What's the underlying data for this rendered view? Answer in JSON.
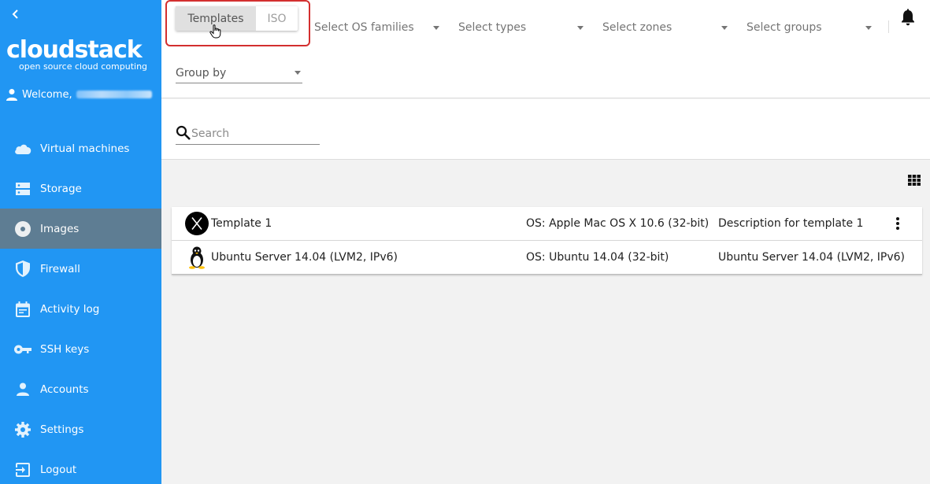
{
  "sidebar": {
    "logo": "cloudstack",
    "tagline": "open source cloud computing",
    "welcome": "Welcome,",
    "items": [
      {
        "label": "Virtual machines",
        "icon": "cloud-icon"
      },
      {
        "label": "Storage",
        "icon": "storage-icon"
      },
      {
        "label": "Images",
        "icon": "disc-icon",
        "active": true
      },
      {
        "label": "Firewall",
        "icon": "shield-icon"
      },
      {
        "label": "Activity log",
        "icon": "calendar-icon"
      },
      {
        "label": "SSH keys",
        "icon": "key-icon"
      },
      {
        "label": "Accounts",
        "icon": "person-icon"
      },
      {
        "label": "Settings",
        "icon": "gear-icon"
      },
      {
        "label": "Logout",
        "icon": "logout-icon"
      }
    ]
  },
  "header": {
    "toggle": {
      "selected": "Templates",
      "other": "ISO"
    },
    "filters": {
      "os_families": "Select OS families",
      "types": "Select types",
      "zones": "Select zones",
      "groups": "Select groups"
    },
    "group_by": "Group by"
  },
  "search": {
    "placeholder": "Search"
  },
  "rows": [
    {
      "icon": "macos-icon",
      "name": "Template 1",
      "os": "OS: Apple Mac OS X 10.6 (32-bit)",
      "description": "Description for template 1"
    },
    {
      "icon": "linux-icon",
      "name": "Ubuntu Server 14.04 (LVM2, IPv6)",
      "os": "OS: Ubuntu 14.04 (32-bit)",
      "description": "Ubuntu Server 14.04 (LVM2, IPv6)"
    }
  ],
  "colors": {
    "sidebar": "#2196f3",
    "active": "#5e7d93",
    "highlight": "#d32f2f"
  }
}
